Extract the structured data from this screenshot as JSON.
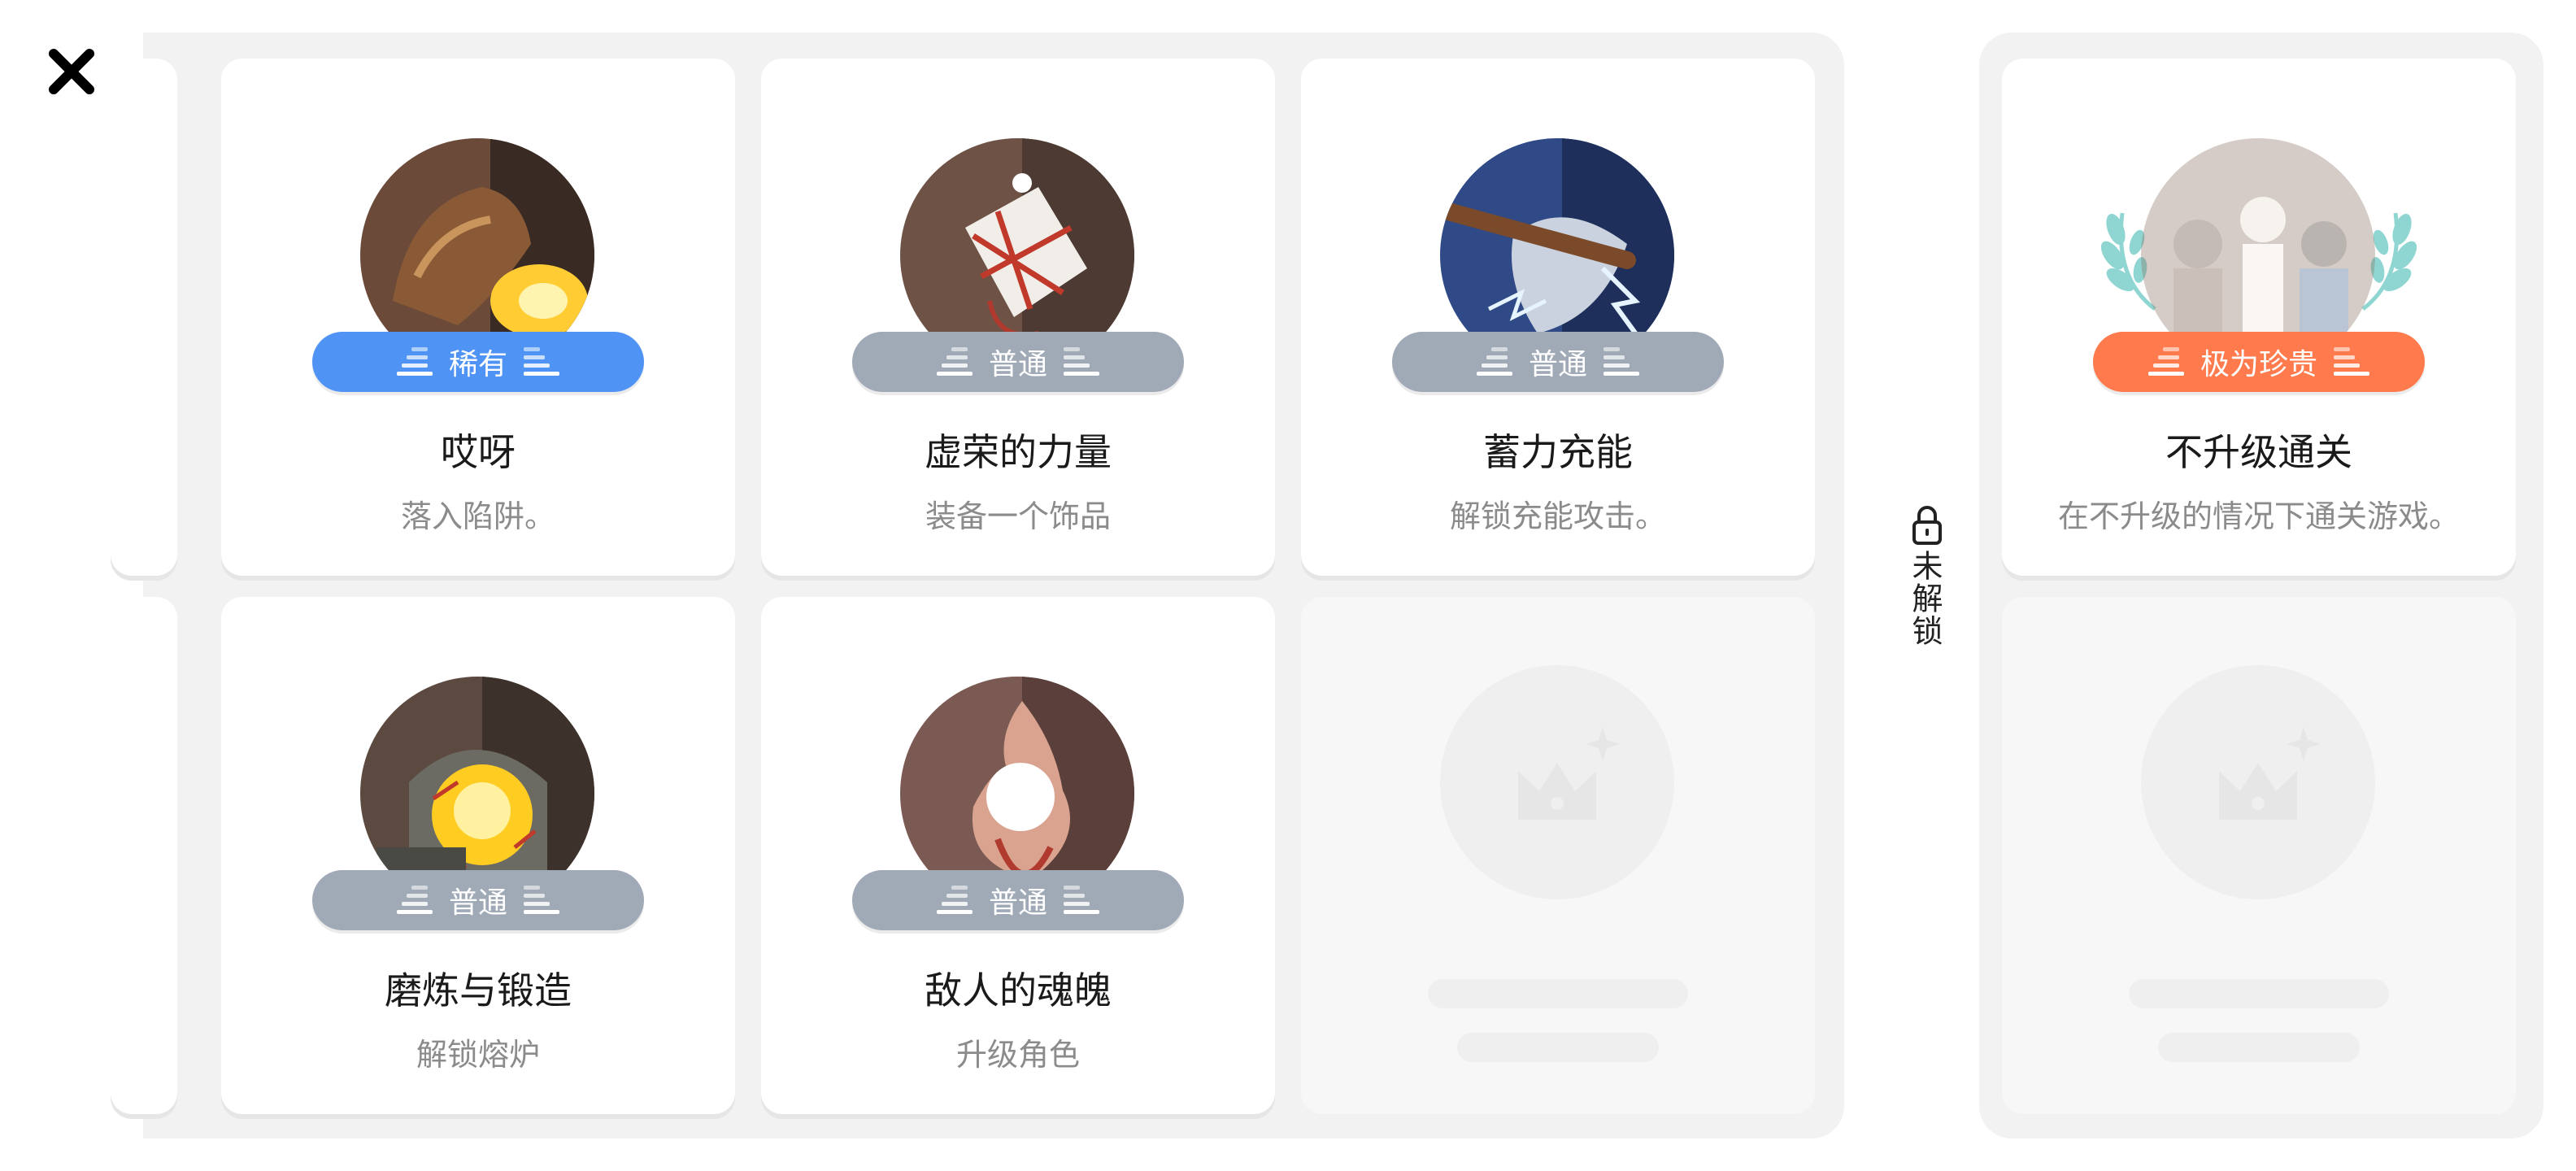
{
  "achievements": [
    {
      "rarity": "稀有",
      "title": "哎呀",
      "desc": "落入陷阱。"
    },
    {
      "rarity": "普通",
      "title": "虚荣的力量",
      "desc": "装备一个饰品"
    },
    {
      "rarity": "普通",
      "title": "蓄力充能",
      "desc": "解锁充能攻击。"
    },
    {
      "rarity": "普通",
      "title": "磨炼与锻造",
      "desc": "解锁熔炉"
    },
    {
      "rarity": "普通",
      "title": "敌人的魂魄",
      "desc": "升级角色"
    }
  ],
  "locked_section": {
    "label": "未解锁"
  },
  "locked_achievement": {
    "rarity": "极为珍贵",
    "title": "不升级通关",
    "desc": "在不升级的情况下通关游戏。"
  },
  "colors": {
    "rare": "#4f94f5",
    "common": "#a0aab6",
    "precious": "#ff7a4c",
    "laurel": "#8fd6d2"
  }
}
